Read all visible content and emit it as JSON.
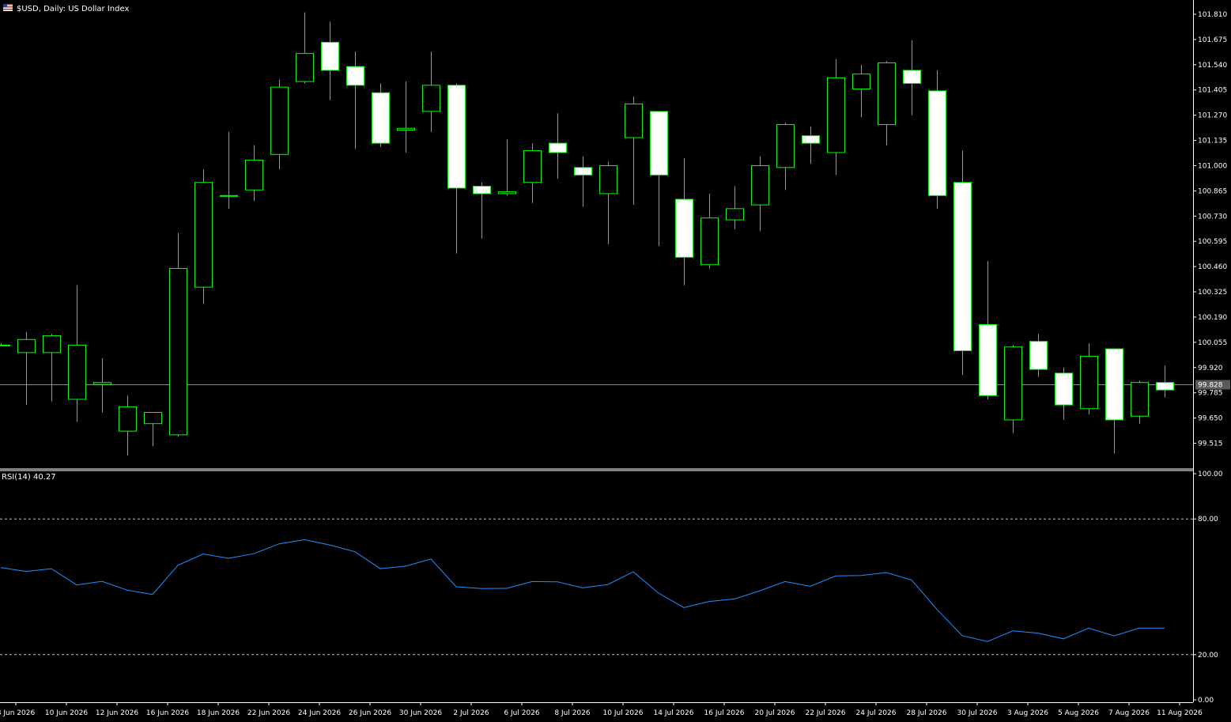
{
  "window": {
    "title": "$USD, Daily:  US Dollar Index",
    "flag_icon": "us-flag-icon"
  },
  "colors": {
    "background": "#000000",
    "candle_border": "#00ff00",
    "candle_bull_fill": "#000000",
    "candle_bear_fill": "#ffffff",
    "rsi_line": "#1e90ff",
    "price_line": "#c0c0c0",
    "axis_text": "#ffffff"
  },
  "price_axis": {
    "ticks": [
      "101.810",
      "101.675",
      "101.540",
      "101.405",
      "101.270",
      "101.135",
      "101.000",
      "100.865",
      "100.730",
      "100.595",
      "100.460",
      "100.325",
      "100.190",
      "100.055",
      "99.920",
      "99.785",
      "99.650",
      "99.515"
    ],
    "current_price_label": "99.828"
  },
  "rsi": {
    "label": "RSI(14) 40.27",
    "ticks": [
      "100.00",
      "80.00",
      "20.00",
      "0.00"
    ]
  },
  "time_axis": {
    "labels": [
      "8 Jun 2026",
      "10 Jun 2026",
      "12 Jun 2026",
      "16 Jun 2026",
      "18 Jun 2026",
      "22 Jun 2026",
      "24 Jun 2026",
      "26 Jun 2026",
      "30 Jun 2026",
      "2 Jul 2026",
      "6 Jul 2026",
      "8 Jul 2026",
      "10 Jul 2026",
      "14 Jul 2026",
      "16 Jul 2026",
      "20 Jul 2026",
      "22 Jul 2026",
      "24 Jul 2026",
      "28 Jul 2026",
      "30 Jul 2026",
      "3 Aug 2026",
      "5 Aug 2026",
      "7 Aug 2026",
      "11 Aug 2026"
    ]
  },
  "chart_data": {
    "type": "candlestick",
    "title": "$USD, Daily:  US Dollar Index",
    "ylim": [
      99.45,
      101.86
    ],
    "current_price": 99.828,
    "candles": [
      {
        "date": "5 Jun 2026",
        "o": 100.04,
        "h": 100.05,
        "l": 100.04,
        "c": 100.04
      },
      {
        "date": "8 Jun 2026",
        "o": 100.0,
        "h": 100.11,
        "l": 99.72,
        "c": 100.07
      },
      {
        "date": "9 Jun 2026",
        "o": 100.0,
        "h": 100.1,
        "l": 99.74,
        "c": 100.09
      },
      {
        "date": "10 Jun 2026",
        "o": 99.75,
        "h": 100.36,
        "l": 99.63,
        "c": 100.04
      },
      {
        "date": "11 Jun 2026",
        "o": 99.83,
        "h": 99.97,
        "l": 99.68,
        "c": 99.84
      },
      {
        "date": "12 Jun 2026",
        "o": 99.58,
        "h": 99.77,
        "l": 99.45,
        "c": 99.71
      },
      {
        "date": "15 Jun 2026",
        "o": 99.62,
        "h": 99.68,
        "l": 99.5,
        "c": 99.68
      },
      {
        "date": "16 Jun 2026",
        "o": 99.56,
        "h": 100.64,
        "l": 99.55,
        "c": 100.45
      },
      {
        "date": "17 Jun 2026",
        "o": 100.35,
        "h": 100.98,
        "l": 100.26,
        "c": 100.91
      },
      {
        "date": "18 Jun 2026",
        "o": 100.84,
        "h": 101.18,
        "l": 100.77,
        "c": 100.84
      },
      {
        "date": "19 Jun 2026",
        "o": 100.87,
        "h": 101.11,
        "l": 100.81,
        "c": 101.03
      },
      {
        "date": "22 Jun 2026",
        "o": 101.06,
        "h": 101.46,
        "l": 100.98,
        "c": 101.42
      },
      {
        "date": "23 Jun 2026",
        "o": 101.45,
        "h": 101.82,
        "l": 101.44,
        "c": 101.6
      },
      {
        "date": "24 Jun 2026",
        "o": 101.66,
        "h": 101.77,
        "l": 101.35,
        "c": 101.51
      },
      {
        "date": "25 Jun 2026",
        "o": 101.53,
        "h": 101.61,
        "l": 101.09,
        "c": 101.43
      },
      {
        "date": "26 Jun 2026",
        "o": 101.39,
        "h": 101.44,
        "l": 101.1,
        "c": 101.12
      },
      {
        "date": "29 Jun 2026",
        "o": 101.19,
        "h": 101.45,
        "l": 101.07,
        "c": 101.2
      },
      {
        "date": "30 Jun 2026",
        "o": 101.29,
        "h": 101.61,
        "l": 101.18,
        "c": 101.43
      },
      {
        "date": "1 Jul 2026",
        "o": 101.43,
        "h": 101.44,
        "l": 100.53,
        "c": 100.88
      },
      {
        "date": "2 Jul 2026",
        "o": 100.89,
        "h": 100.91,
        "l": 100.61,
        "c": 100.85
      },
      {
        "date": "3 Jul 2026",
        "o": 100.85,
        "h": 101.14,
        "l": 100.84,
        "c": 100.86
      },
      {
        "date": "6 Jul 2026",
        "o": 100.91,
        "h": 101.12,
        "l": 100.8,
        "c": 101.08
      },
      {
        "date": "7 Jul 2026",
        "o": 101.12,
        "h": 101.28,
        "l": 100.93,
        "c": 101.07
      },
      {
        "date": "8 Jul 2026",
        "o": 100.99,
        "h": 101.05,
        "l": 100.78,
        "c": 100.95
      },
      {
        "date": "9 Jul 2026",
        "o": 100.85,
        "h": 101.02,
        "l": 100.58,
        "c": 101.0
      },
      {
        "date": "10 Jul 2026",
        "o": 101.15,
        "h": 101.37,
        "l": 100.79,
        "c": 101.33
      },
      {
        "date": "13 Jul 2026",
        "o": 101.29,
        "h": 101.29,
        "l": 100.57,
        "c": 100.95
      },
      {
        "date": "14 Jul 2026",
        "o": 100.82,
        "h": 101.04,
        "l": 100.36,
        "c": 100.51
      },
      {
        "date": "15 Jul 2026",
        "o": 100.47,
        "h": 100.85,
        "l": 100.45,
        "c": 100.72
      },
      {
        "date": "16 Jul 2026",
        "o": 100.71,
        "h": 100.89,
        "l": 100.66,
        "c": 100.77
      },
      {
        "date": "17 Jul 2026",
        "o": 100.79,
        "h": 101.05,
        "l": 100.65,
        "c": 101.0
      },
      {
        "date": "20 Jul 2026",
        "o": 100.99,
        "h": 101.23,
        "l": 100.87,
        "c": 101.22
      },
      {
        "date": "21 Jul 2026",
        "o": 101.16,
        "h": 101.21,
        "l": 101.01,
        "c": 101.12
      },
      {
        "date": "22 Jul 2026",
        "o": 101.07,
        "h": 101.57,
        "l": 100.95,
        "c": 101.47
      },
      {
        "date": "23 Jul 2026",
        "o": 101.41,
        "h": 101.54,
        "l": 101.26,
        "c": 101.49
      },
      {
        "date": "24 Jul 2026",
        "o": 101.22,
        "h": 101.56,
        "l": 101.11,
        "c": 101.55
      },
      {
        "date": "27 Jul 2026",
        "o": 101.51,
        "h": 101.67,
        "l": 101.27,
        "c": 101.44
      },
      {
        "date": "28 Jul 2026",
        "o": 101.4,
        "h": 101.51,
        "l": 100.77,
        "c": 100.84
      },
      {
        "date": "29 Jul 2026",
        "o": 100.91,
        "h": 101.08,
        "l": 99.88,
        "c": 100.01
      },
      {
        "date": "30 Jul 2026",
        "o": 100.15,
        "h": 100.49,
        "l": 99.75,
        "c": 99.77
      },
      {
        "date": "31 Jul 2026",
        "o": 99.64,
        "h": 100.04,
        "l": 99.57,
        "c": 100.03
      },
      {
        "date": "3 Aug 2026",
        "o": 100.06,
        "h": 100.1,
        "l": 99.87,
        "c": 99.91
      },
      {
        "date": "4 Aug 2026",
        "o": 99.89,
        "h": 99.92,
        "l": 99.64,
        "c": 99.72
      },
      {
        "date": "5 Aug 2026",
        "o": 99.7,
        "h": 100.05,
        "l": 99.67,
        "c": 99.98
      },
      {
        "date": "6 Aug 2026",
        "o": 100.02,
        "h": 100.02,
        "l": 99.46,
        "c": 99.64
      },
      {
        "date": "7 Aug 2026",
        "o": 99.66,
        "h": 99.85,
        "l": 99.62,
        "c": 99.84
      },
      {
        "date": "10 Aug 2026",
        "o": 99.84,
        "h": 99.93,
        "l": 99.76,
        "c": 99.8
      }
    ],
    "rsi_series": {
      "levels": [
        80,
        20
      ],
      "ylim": [
        0,
        100
      ],
      "values": [
        58.5,
        56.8,
        58.0,
        50.8,
        52.4,
        48.5,
        46.6,
        59.5,
        64.5,
        62.6,
        64.6,
        69.0,
        70.8,
        68.5,
        65.5,
        58.0,
        59.1,
        62.3,
        50.0,
        49.2,
        49.3,
        52.3,
        52.2,
        49.5,
        51.0,
        56.6,
        47.2,
        40.8,
        43.5,
        44.6,
        48.2,
        52.3,
        50.2,
        54.8,
        55.0,
        56.3,
        53.0,
        40.0,
        28.4,
        25.8,
        30.5,
        29.5,
        27.0,
        31.7,
        28.3,
        31.7,
        31.7
      ]
    }
  }
}
